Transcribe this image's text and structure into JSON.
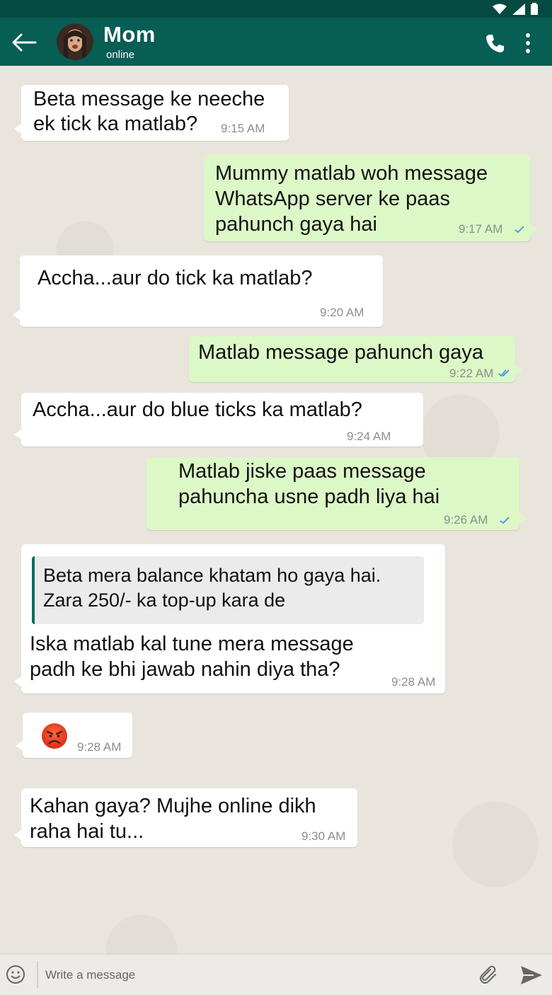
{
  "header": {
    "contact_name": "Mom",
    "status": "online"
  },
  "messages": [
    {
      "direction": "incoming",
      "lines": [
        "Beta message ke neeche",
        "ek tick ka matlab?"
      ],
      "time": "9:15 AM"
    },
    {
      "direction": "outgoing",
      "lines": [
        "Mummy matlab woh message",
        "WhatsApp server ke paas",
        "pahunch gaya hai"
      ],
      "time": "9:17 AM",
      "ticks": "single"
    },
    {
      "direction": "incoming",
      "lines": [
        "Accha...aur do tick ka matlab?"
      ],
      "time": "9:20 AM"
    },
    {
      "direction": "outgoing",
      "lines": [
        "Matlab message pahunch gaya"
      ],
      "time": "9:22 AM",
      "ticks": "double"
    },
    {
      "direction": "incoming",
      "lines": [
        "Accha...aur do blue ticks ka matlab?"
      ],
      "time": "9:24 AM"
    },
    {
      "direction": "outgoing",
      "lines": [
        "Matlab jiske paas message",
        "pahuncha usne padh liya hai"
      ],
      "time": "9:26 AM",
      "ticks": "single"
    },
    {
      "direction": "incoming",
      "quote": [
        "Beta mera balance khatam ho gaya hai.",
        "Zara 250/- ka top-up kara de"
      ],
      "lines": [
        "Iska matlab kal tune mera message",
        "padh ke bhi jawab nahin diya tha?"
      ],
      "time": "9:28 AM"
    },
    {
      "direction": "incoming",
      "emoji": "angry-face",
      "time": "9:28 AM"
    },
    {
      "direction": "incoming",
      "lines": [
        "Kahan gaya? Mujhe online dikh",
        "raha hai tu..."
      ],
      "time": "9:30 AM"
    }
  ],
  "composer": {
    "placeholder": "Write a message",
    "value": ""
  },
  "colors": {
    "appbar": "#075e54",
    "statusbar": "#054a40",
    "outgoing_bubble": "#dcf8c6",
    "incoming_bubble": "#ffffff",
    "tick": "#4fa3e0"
  }
}
